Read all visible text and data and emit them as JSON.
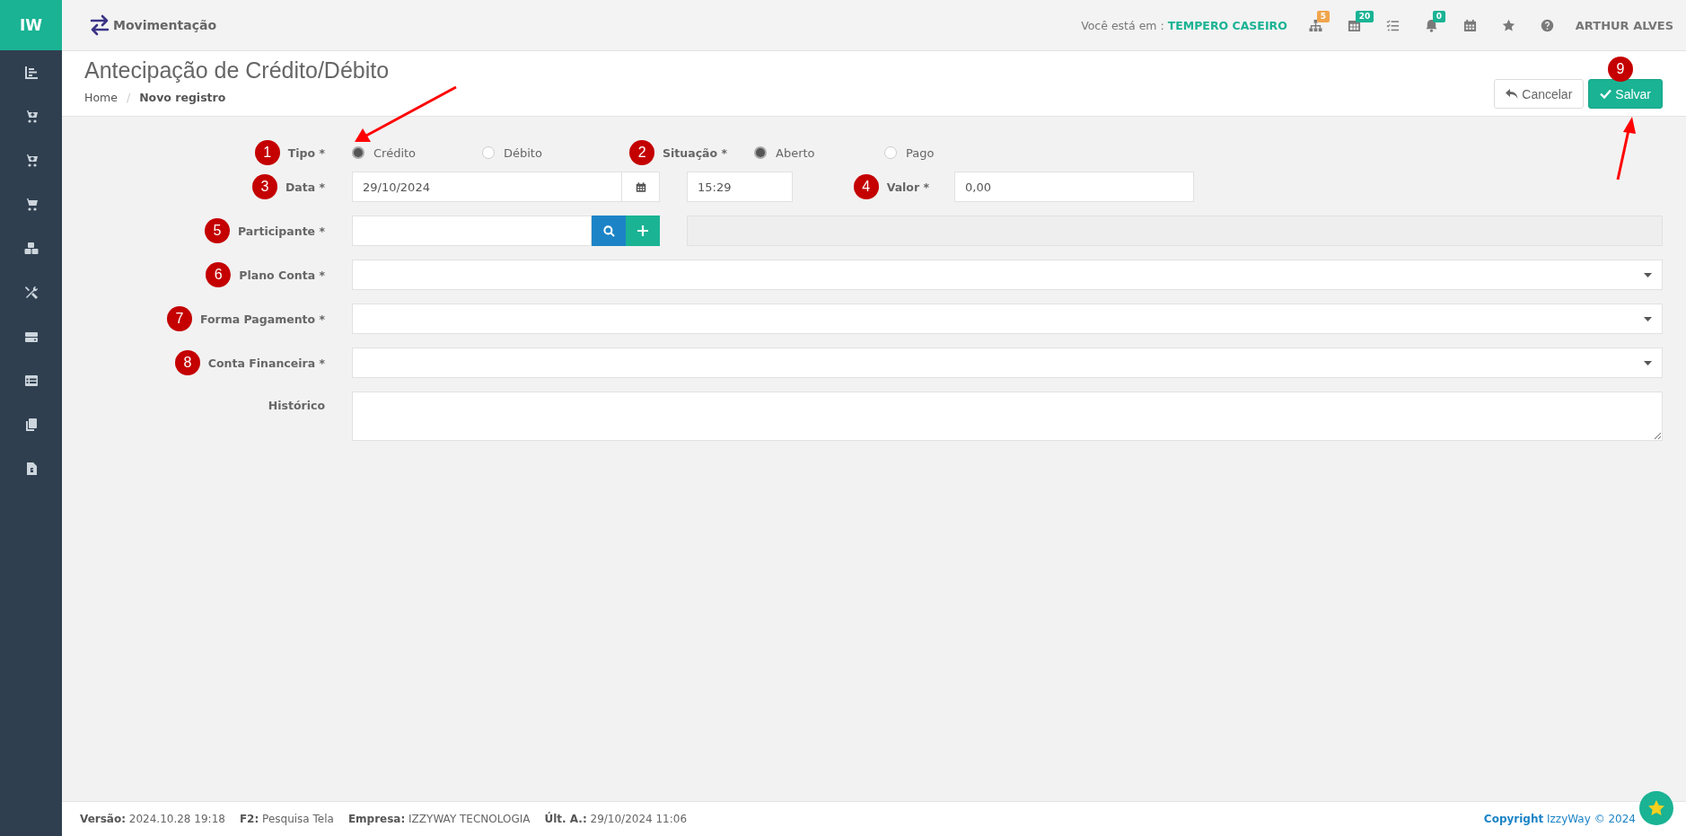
{
  "topbar": {
    "logo": "IW",
    "module": "Movimentação",
    "location_prefix": "Você está em :",
    "location": "TEMPERO CASEIRO",
    "badges": [
      {
        "text": "5",
        "color": "#f0a54b"
      },
      {
        "text": "20",
        "color": "#1ab394"
      },
      {
        "text": "0",
        "color": "#1ab394"
      }
    ],
    "user": "ARTHUR ALVES"
  },
  "header": {
    "title": "Antecipação de Crédito/Débito",
    "breadcrumb": [
      "Home",
      "Novo registro"
    ],
    "breadcrumb_separator": "/",
    "cancel_button": "Cancelar",
    "save_button": "Salvar",
    "save_marker": "9"
  },
  "form": {
    "tipo": {
      "marker": "1",
      "label": "Tipo *",
      "options": [
        {
          "label": "Crédito",
          "selected": true
        },
        {
          "label": "Débito",
          "selected": false
        }
      ]
    },
    "situacao": {
      "marker": "2",
      "label": "Situação *",
      "options": [
        {
          "label": "Aberto",
          "selected": true
        },
        {
          "label": "Pago",
          "selected": false
        }
      ]
    },
    "data": {
      "marker": "3",
      "label": "Data *",
      "value": "29/10/2024",
      "time": "15:29"
    },
    "valor": {
      "marker": "4",
      "label": "Valor *",
      "value": "0,00"
    },
    "participante": {
      "marker": "5",
      "label": "Participante *"
    },
    "selects": [
      {
        "marker": "6",
        "label": "Plano Conta *"
      },
      {
        "marker": "7",
        "label": "Forma Pagamento *"
      },
      {
        "marker": "8",
        "label": "Conta Financeira *"
      }
    ],
    "historico": {
      "label": "Histórico"
    }
  },
  "footer": {
    "items": [
      {
        "key": "Versão:",
        "value": "2024.10.28 19:18"
      },
      {
        "key": "F2:",
        "value": "Pesquisa Tela"
      },
      {
        "key": "Empresa:",
        "value": "IZZYWAY TECNOLOGIA"
      },
      {
        "key": "Últ. A.:",
        "value": "29/10/2024 11:06"
      }
    ],
    "copyright": {
      "label": "Copyright",
      "brand": "IzzyWay © 2024"
    }
  }
}
